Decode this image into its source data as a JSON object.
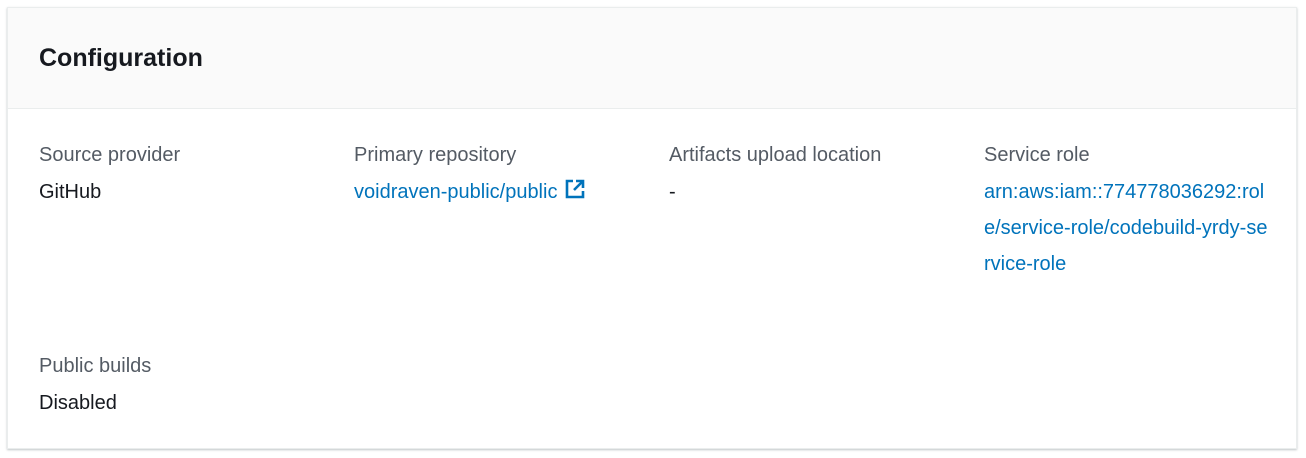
{
  "panel": {
    "title": "Configuration"
  },
  "fields": {
    "source_provider": {
      "label": "Source provider",
      "value": "GitHub"
    },
    "primary_repository": {
      "label": "Primary repository",
      "value": "voidraven-public/public",
      "icon": "external-link-icon"
    },
    "artifacts_upload_location": {
      "label": "Artifacts upload location",
      "value": "-"
    },
    "service_role": {
      "label": "Service role",
      "value": "arn:aws:iam::774778036292:role/service-role/codebuild-yrdy-service-role"
    },
    "public_builds": {
      "label": "Public builds",
      "value": "Disabled"
    }
  },
  "colors": {
    "link": "#0073bb",
    "label": "#545b64",
    "text": "#16191f",
    "header_bg": "#fafafa"
  }
}
